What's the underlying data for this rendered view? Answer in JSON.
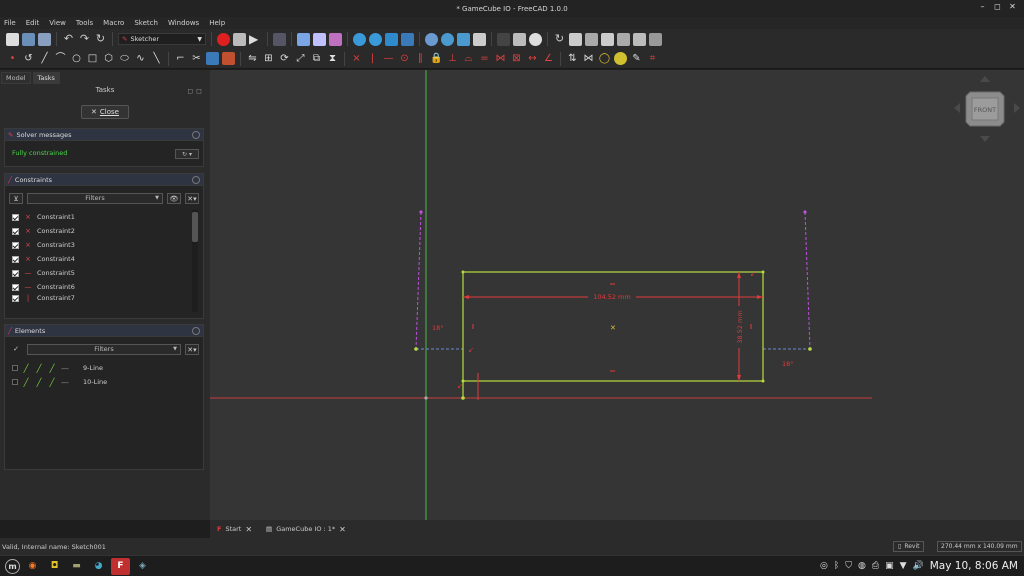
{
  "window": {
    "title": "* GameCube IO - FreeCAD 1.0.0",
    "controls": [
      "–",
      "◻",
      "✕"
    ]
  },
  "menu": [
    "File",
    "Edit",
    "View",
    "Tools",
    "Macro",
    "Sketch",
    "Windows",
    "Help"
  ],
  "workbench": {
    "label": "Sketcher"
  },
  "left_panel": {
    "tabs": [
      "Model",
      "Tasks"
    ],
    "tasks_header": "Tasks",
    "close_label": "Close",
    "solver": {
      "title": "Solver messages",
      "status": "Fully constrained"
    },
    "constraints": {
      "title": "Constraints",
      "filter_label": "Filters",
      "items": [
        {
          "label": "Constraint1",
          "icon": "×"
        },
        {
          "label": "Constraint2",
          "icon": "×"
        },
        {
          "label": "Constraint3",
          "icon": "×"
        },
        {
          "label": "Constraint4",
          "icon": "×"
        },
        {
          "label": "Constraint5",
          "icon": "—"
        },
        {
          "label": "Constraint6",
          "icon": "—"
        },
        {
          "label": "Constraint7",
          "icon": "|"
        }
      ]
    },
    "elements": {
      "title": "Elements",
      "filter_label": "Filters",
      "items": [
        {
          "label": "9-Line"
        },
        {
          "label": "10-Line"
        }
      ]
    }
  },
  "sketch": {
    "dim_horizontal": "104.52 mm",
    "dim_vertical": "38.52 mm",
    "angle_left": "18°",
    "angle_right": "18°"
  },
  "navcube": {
    "face": "FRONT"
  },
  "doc_tabs": [
    {
      "label": "Start"
    },
    {
      "label": "GameCube IO : 1*"
    }
  ],
  "status": {
    "message": "Valid, Internal name: Sketch001",
    "nav_style": "Revit",
    "dimensions": "270.44 mm x 140.09 mm"
  },
  "taskbar": {
    "clock": "May 10,  8:06 AM"
  },
  "colors": {
    "constrained_green": "#b8dc3c",
    "constraint_red": "#e03a3a",
    "axis_green": "#46b846",
    "axis_red": "#c84040",
    "guide_magenta": "#c050e0"
  }
}
